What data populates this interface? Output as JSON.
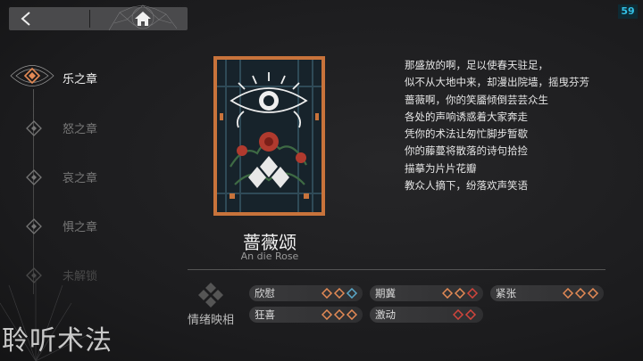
{
  "fps": "59",
  "chapters": [
    {
      "label": "乐之章",
      "state": "active"
    },
    {
      "label": "怒之章",
      "state": "normal"
    },
    {
      "label": "哀之章",
      "state": "normal"
    },
    {
      "label": "惧之章",
      "state": "normal"
    },
    {
      "label": "未解锁",
      "state": "locked"
    }
  ],
  "song": {
    "title": "蔷薇颂",
    "subtitle": "An die Rose"
  },
  "lyrics": [
    "那盛放的啊，足以使春天驻足，",
    "似不从大地中来，却漫出院墙，摇曳芬芳",
    "蔷薇啊，你的笑靥倾倒芸芸众生",
    "各处的声响诱惑着大家奔走",
    "凭你的术法让匆忙脚步暂歇",
    "你的藤蔓将散落的诗句拾捡",
    "描摹为片片花瓣",
    "教众人摘下，纷落欢声笑语"
  ],
  "emotion": {
    "label": "情绪映相",
    "tags": [
      {
        "name": "欣慰",
        "levels": [
          "orange",
          "orange",
          "blue"
        ]
      },
      {
        "name": "期冀",
        "levels": [
          "orange",
          "orange",
          "red"
        ]
      },
      {
        "name": "紧张",
        "levels": [
          "orange",
          "orange",
          "orange"
        ]
      },
      {
        "name": "狂喜",
        "levels": [
          "orange",
          "orange",
          "orange"
        ]
      },
      {
        "name": "激动",
        "levels": [
          "red",
          "red"
        ]
      }
    ]
  },
  "colors": {
    "orange": "#e48a55",
    "blue": "#5aa8c9",
    "red": "#d2453c",
    "accent": "#33c0e6"
  },
  "watermark": "聆听术法"
}
